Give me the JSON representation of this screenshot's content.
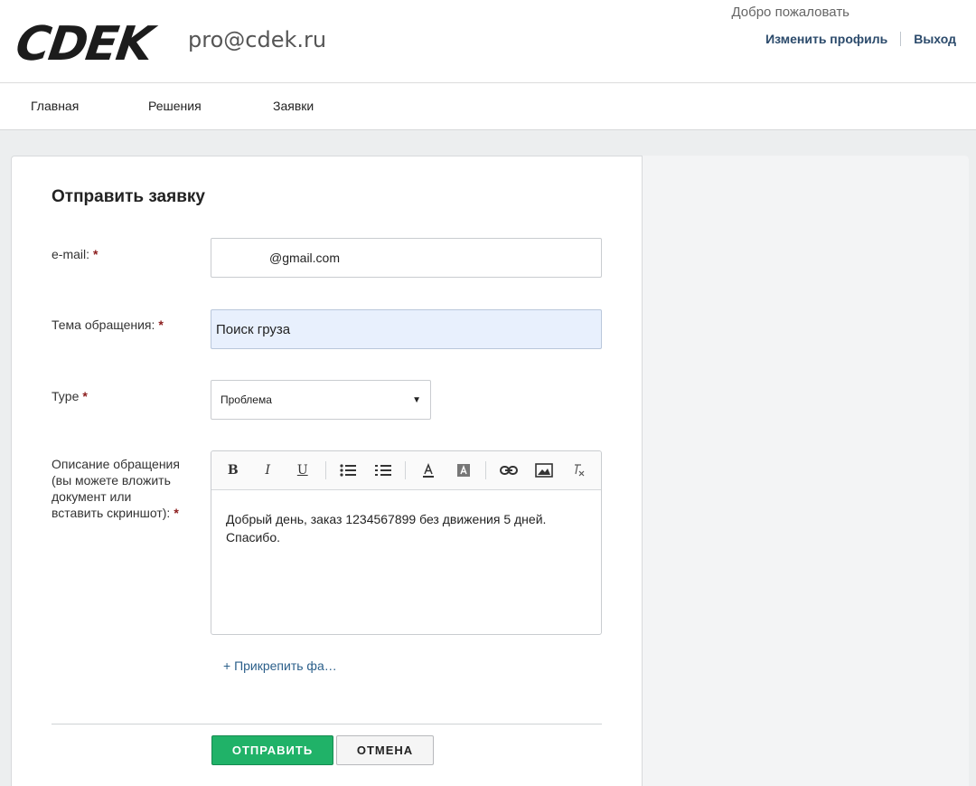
{
  "header": {
    "logo_text": "CDEK",
    "site_email": "pro@cdek.ru",
    "welcome": "Добро пожаловать",
    "links": {
      "edit_profile": "Изменить профиль",
      "logout": "Выход"
    }
  },
  "nav": {
    "items": [
      "Главная",
      "Решения",
      "Заявки"
    ]
  },
  "form": {
    "title": "Отправить заявку",
    "email": {
      "label": "e-mail:",
      "value": "@gmail.com"
    },
    "subject": {
      "label": "Тема обращения:",
      "value": "Поиск груза"
    },
    "type": {
      "label": "Type",
      "value": "Проблема"
    },
    "description": {
      "label_lines": [
        "Описание обращения",
        "(вы можете вложить",
        "документ или",
        "вставить скриншот):"
      ],
      "line1": "Добрый день, заказ 1234567899 без движения 5 дней.",
      "line2": "Спасибо."
    },
    "required_mark": "*",
    "attach": "+ Прикрепить фа…",
    "buttons": {
      "submit": "ОТПРАВИТЬ",
      "cancel": "ОТМЕНА"
    },
    "toolbar": {
      "bold": "B",
      "italic": "I",
      "underline": "U",
      "icons": [
        "bold-icon",
        "italic-icon",
        "underline-icon",
        "bulleted-list-icon",
        "numbered-list-icon",
        "text-color-icon",
        "background-color-icon",
        "link-icon",
        "image-icon",
        "clear-format-icon"
      ]
    }
  },
  "colors": {
    "accent_green": "#20b268",
    "link_blue": "#2b4a6b",
    "required": "#8b1c1c"
  }
}
